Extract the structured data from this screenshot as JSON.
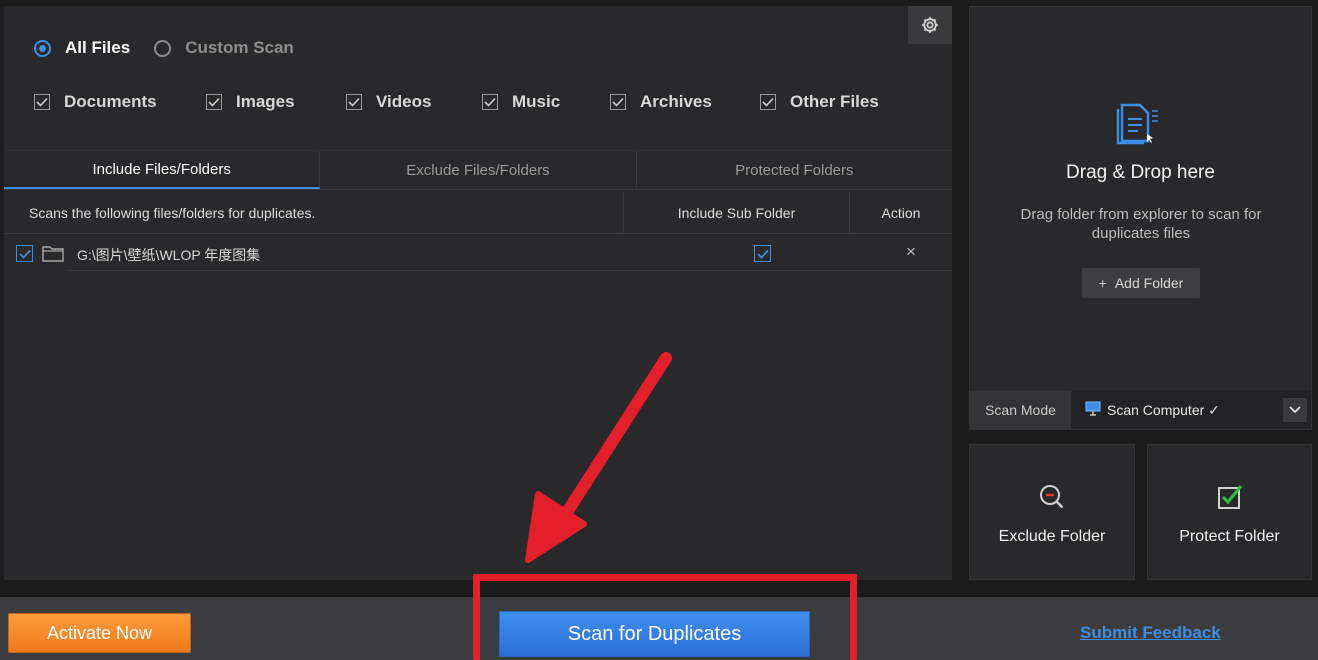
{
  "scan_type": {
    "options": [
      {
        "label": "All Files",
        "selected": true
      },
      {
        "label": "Custom Scan",
        "selected": false
      }
    ]
  },
  "file_types": [
    {
      "label": "Documents",
      "checked": true
    },
    {
      "label": "Images",
      "checked": true
    },
    {
      "label": "Videos",
      "checked": true
    },
    {
      "label": "Music",
      "checked": true
    },
    {
      "label": "Archives",
      "checked": true
    },
    {
      "label": "Other Files",
      "checked": true
    }
  ],
  "tabs": [
    {
      "label": "Include Files/Folders",
      "active": true
    },
    {
      "label": "Exclude Files/Folders",
      "active": false
    },
    {
      "label": "Protected Folders",
      "active": false
    }
  ],
  "table": {
    "col_description": "Scans the following files/folders for duplicates.",
    "col_subfolder": "Include Sub Folder",
    "col_action": "Action",
    "rows": [
      {
        "path": "G:\\图片\\壁纸\\WLOP 年度图集",
        "checked": true,
        "include_sub": true,
        "action": "×"
      }
    ]
  },
  "drop_zone": {
    "title": "Drag & Drop here",
    "subtitle": "Drag folder from explorer to scan for duplicates files",
    "add_button": "Add Folder",
    "add_icon": "+"
  },
  "scan_mode": {
    "label": "Scan Mode",
    "value": "Scan Computer ✓"
  },
  "tiles": {
    "exclude": "Exclude Folder",
    "protect": "Protect Folder"
  },
  "bottom": {
    "activate": "Activate Now",
    "scan": "Scan for Duplicates",
    "feedback": "Submit Feedback"
  },
  "colors": {
    "accent": "#3d8fe6",
    "activate": "#f28a2a",
    "annotation": "#e3202a"
  }
}
